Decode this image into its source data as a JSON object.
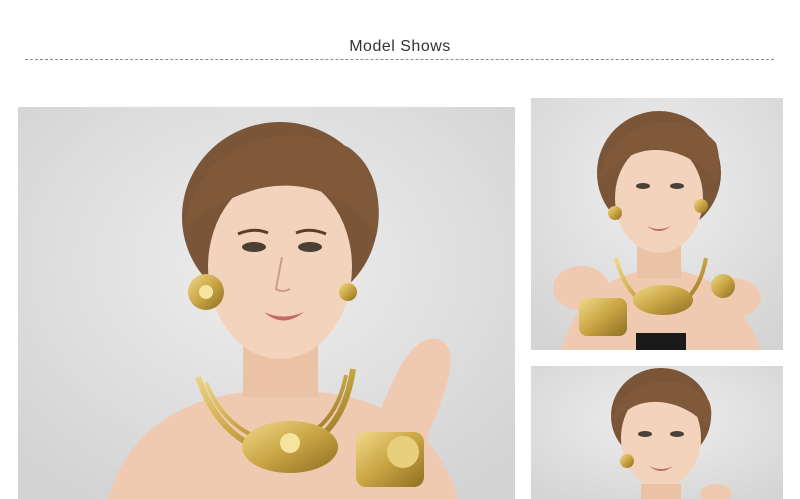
{
  "section": {
    "title": "Model Shows"
  },
  "colors": {
    "background": "#ffffff",
    "title_text": "#333333",
    "divider": "#8a8a8a",
    "photo_backdrop": "#dcdcdc",
    "hair": "#7a5538",
    "skin": "#f1cfb6",
    "gold": "#c9a544"
  },
  "photos": [
    {
      "name": "model-photo-large",
      "icon": "model-portrait-image"
    },
    {
      "name": "model-photo-small-top",
      "icon": "model-portrait-image"
    },
    {
      "name": "model-photo-small-bottom",
      "icon": "model-portrait-image"
    }
  ]
}
